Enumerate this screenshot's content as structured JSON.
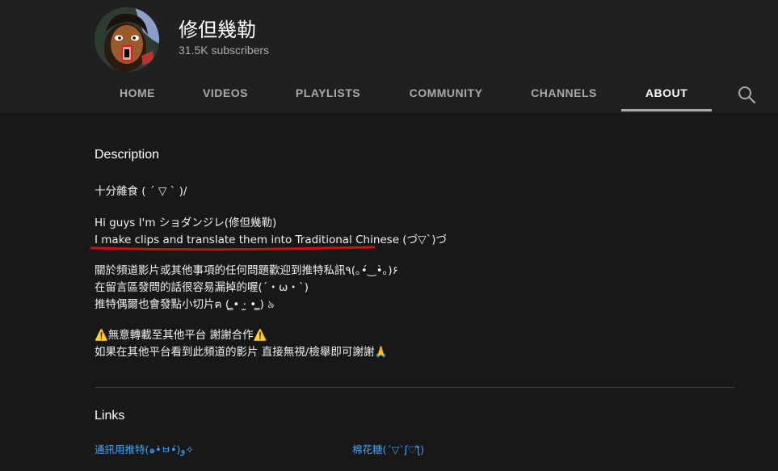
{
  "channel": {
    "name": "修但幾勒",
    "subscribers": "31.5K subscribers"
  },
  "tabs": [
    {
      "label": "HOME"
    },
    {
      "label": "VIDEOS"
    },
    {
      "label": "PLAYLISTS"
    },
    {
      "label": "COMMUNITY"
    },
    {
      "label": "CHANNELS"
    },
    {
      "label": "ABOUT",
      "active": true
    }
  ],
  "search": {
    "icon": "search-icon"
  },
  "description": {
    "title": "Description",
    "lines": [
      "十分雜食 ( ´ ▽ ` )/",
      "Hi guys I'm ショダンジレ(修但幾勒)",
      "I make clips and translate them into Traditional Chinese (づ▽`)づ",
      "關於頻道影片或其他事項的任何問題歡迎到推特私訊٩(｡•́‿•̀｡)۶",
      "在留言區發問的話很容易漏掉的喔(´・ω・`)",
      "推特偶爾也會發點小切片ฅ ( ̳• ·̫ • ̳) ৯",
      "⚠️無意轉載至其他平台 謝謝合作⚠️",
      "如果在其他平台看到此頻道的影片 直接無視/檢舉即可謝謝🙏"
    ]
  },
  "links": {
    "title": "Links",
    "items": [
      {
        "label": "通訊用推特(๑•̀ㅂ•́)و✧"
      },
      {
        "label": "棉花糖(´▽`ʃ♡ƪ)"
      }
    ]
  },
  "colors": {
    "header_bg": "#202020",
    "page_bg": "#181818",
    "link": "#3ea6ff",
    "annotation": "#cc1111"
  }
}
